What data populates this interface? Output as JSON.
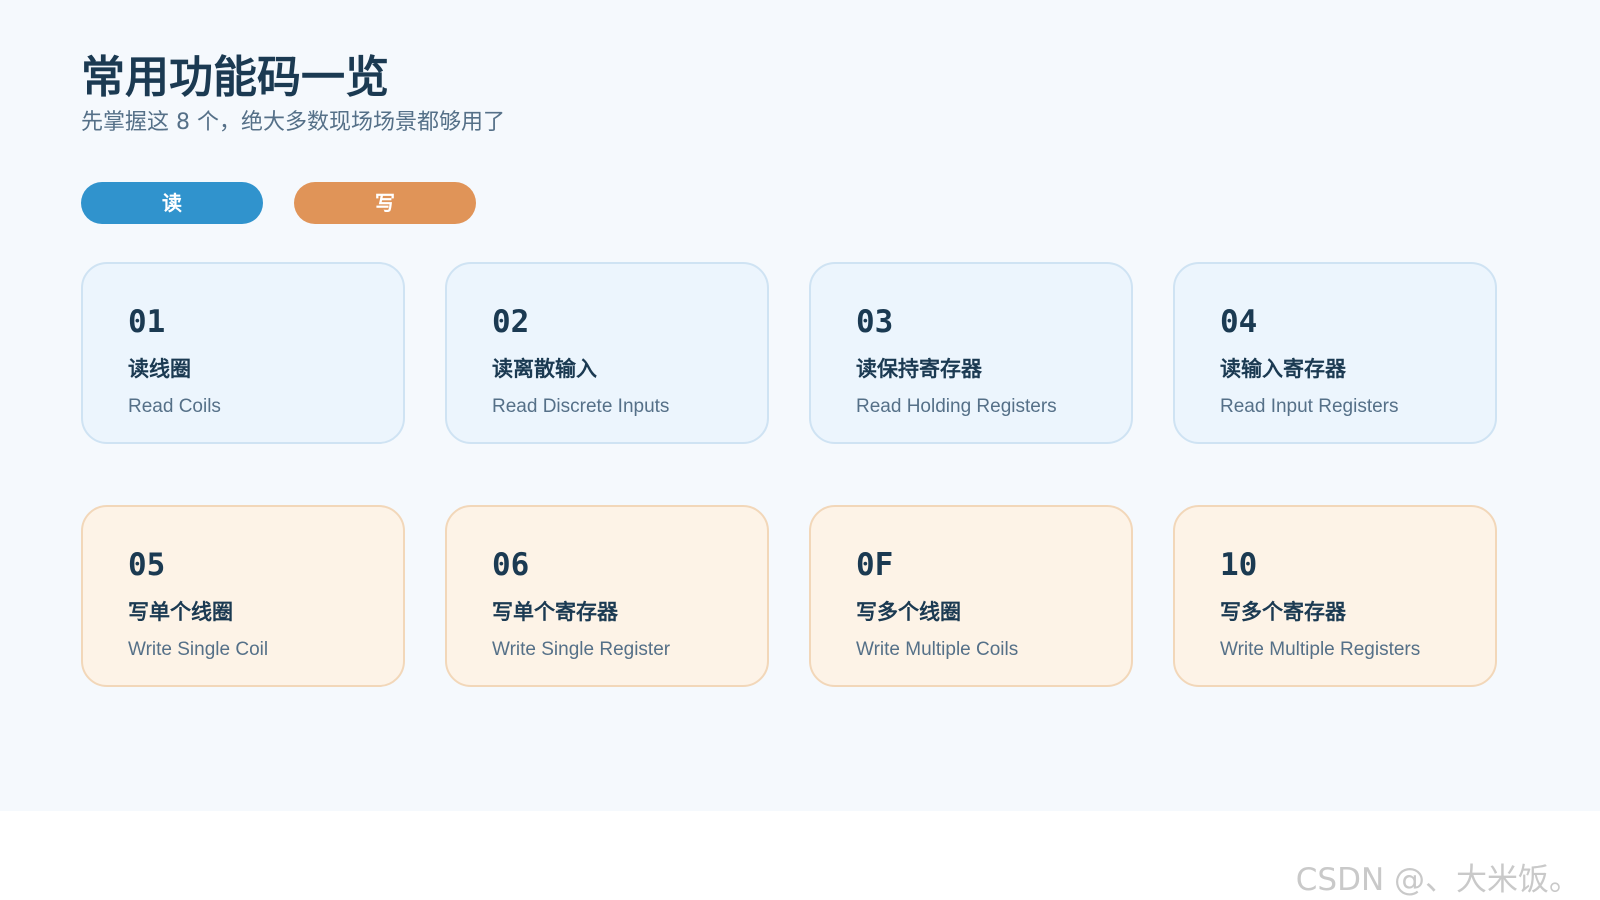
{
  "header": {
    "title": "常用功能码一览",
    "subtitle": "先掌握这 8 个，绝大多数现场场景都够用了"
  },
  "legend": {
    "read_label": "读",
    "write_label": "写",
    "read_color": "#3093cd",
    "write_color": "#e09458"
  },
  "cards": [
    {
      "code": "01",
      "name_zh": "读线圈",
      "name_en": "Read Coils",
      "kind": "read"
    },
    {
      "code": "02",
      "name_zh": "读离散输入",
      "name_en": "Read Discrete Inputs",
      "kind": "read"
    },
    {
      "code": "03",
      "name_zh": "读保持寄存器",
      "name_en": "Read Holding Registers",
      "kind": "read"
    },
    {
      "code": "04",
      "name_zh": "读输入寄存器",
      "name_en": "Read Input Registers",
      "kind": "read"
    },
    {
      "code": "05",
      "name_zh": "写单个线圈",
      "name_en": "Write Single Coil",
      "kind": "write"
    },
    {
      "code": "06",
      "name_zh": "写单个寄存器",
      "name_en": "Write Single Register",
      "kind": "write"
    },
    {
      "code": "0F",
      "name_zh": "写多个线圈",
      "name_en": "Write Multiple Coils",
      "kind": "write"
    },
    {
      "code": "10",
      "name_zh": "写多个寄存器",
      "name_en": "Write Multiple Registers",
      "kind": "write"
    }
  ],
  "watermark": "CSDN @、大米饭。"
}
